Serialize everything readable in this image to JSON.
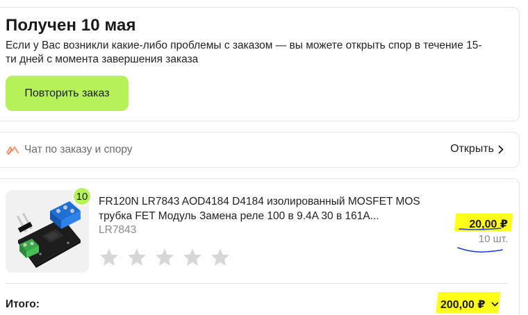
{
  "status": {
    "title": "Получен 10 мая",
    "text": "Если у Вас возникли какие-либо проблемы с заказом — вы можете открыть спор в течение 15-ти дней с момента завершения заказа",
    "repeat_button": "Повторить заказ"
  },
  "chat": {
    "icon": "chat-arrows-icon",
    "label": "Чат по заказу и спору",
    "open_label": "Открыть"
  },
  "order": {
    "quantity_badge": "10",
    "product_title": "FR120N LR7843 AOD4184 D4184 изолированный MOSFET MOS трубка FET Модуль Замена реле 100 в 9.4A 30 в 161A...",
    "sku": "LR7843",
    "rating": {
      "value": 0,
      "max": 5
    },
    "unit_price": "20,00 ₽",
    "unit_qty": "10 шт.",
    "total_label": "Итого:",
    "total_value": "200,00 ₽"
  },
  "colors": {
    "accent": "#b5f25a",
    "highlight": "#ffff1a",
    "scribble": "#1a3ccc",
    "star": "#d6d6d6"
  }
}
